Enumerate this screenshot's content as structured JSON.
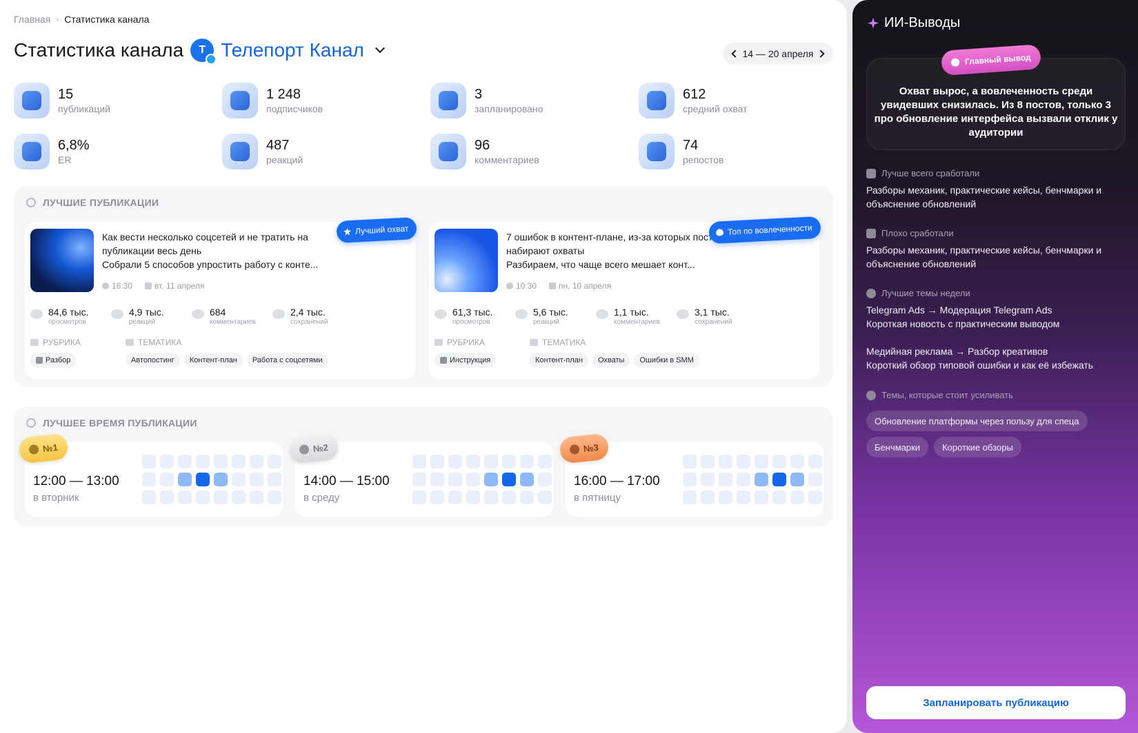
{
  "breadcrumb": {
    "home": "Главная",
    "current": "Статистика канала"
  },
  "header": {
    "title": "Статистика канала",
    "channel": "Телепорт Канал",
    "date_range": "14 — 20 апреля"
  },
  "stats": [
    {
      "value": "15",
      "label": "публикаций",
      "icon": "publications-icon"
    },
    {
      "value": "1 248",
      "label": "подписчиков",
      "icon": "subscribers-icon"
    },
    {
      "value": "3",
      "label": "запланировано",
      "icon": "scheduled-icon"
    },
    {
      "value": "612",
      "label": "средний охват",
      "icon": "reach-icon"
    },
    {
      "value": "6,8%",
      "label": "ER",
      "icon": "target-icon"
    },
    {
      "value": "487",
      "label": "реакций",
      "icon": "thumb-up-icon"
    },
    {
      "value": "96",
      "label": "комментариев",
      "icon": "comments-icon"
    },
    {
      "value": "74",
      "label": "репостов",
      "icon": "repost-icon"
    }
  ],
  "best": {
    "title": "ЛУЧШИЕ ПУБЛИКАЦИИ",
    "rubric_label": "РУБРИКА",
    "theme_label": "ТЕМАТИКА",
    "cards": [
      {
        "badge": "Лучший охват",
        "title": "Как вести несколько соцсетей и не тратить на публикации весь день",
        "excerpt": "Собрали 5 способов упростить работу с конте...",
        "time": "16:30",
        "date": "вт, 11 апреля",
        "metrics": [
          {
            "value": "84,6 тыс.",
            "label": "просмотров"
          },
          {
            "value": "4,9 тыс.",
            "label": "реакций"
          },
          {
            "value": "684",
            "label": "комментариев"
          },
          {
            "value": "2,4 тыс.",
            "label": "сохранений"
          }
        ],
        "rubric": "Разбор",
        "themes": [
          "Автопостинг",
          "Контент-план",
          "Работа с соцсетями"
        ]
      },
      {
        "badge": "Топ по вовлеченности",
        "title": "7 ошибок в контент-плане, из-за которых посты не набирают охваты",
        "excerpt": "Разбираем, что чаще всего мешает конт...",
        "time": "10:30",
        "date": "пн, 10 апреля",
        "metrics": [
          {
            "value": "61,3 тыс.",
            "label": "просмотров"
          },
          {
            "value": "5,6 тыс.",
            "label": "реакций"
          },
          {
            "value": "1,1 тыс.",
            "label": "комментариев"
          },
          {
            "value": "3,1 тыс.",
            "label": "сохранений"
          }
        ],
        "rubric": "Инструкция",
        "themes": [
          "Контент-план",
          "Охваты",
          "Ошибки в SMM"
        ]
      }
    ]
  },
  "best_time": {
    "title": "ЛУЧШЕЕ ВРЕМЯ ПУБЛИКАЦИИ",
    "slots": [
      {
        "rank": "№1",
        "range": "12:00 — 13:00",
        "day": "в вторник"
      },
      {
        "rank": "№2",
        "range": "14:00 — 15:00",
        "day": "в среду"
      },
      {
        "rank": "№3",
        "range": "16:00 — 17:00",
        "day": "в пятницу"
      }
    ]
  },
  "ai": {
    "title": "ИИ-Выводы",
    "main_badge": "Главный вывод",
    "main_text": "Охват вырос, а вовлеченность среди увидевших снизилась. Из 8 постов, только 3 про обновление интерфейса вызвали отклик у аудитории",
    "best": {
      "title": "Лучше всего сработали",
      "text": "Разборы механик, практические кейсы, бенчмарки и объяснение обновлений"
    },
    "worst": {
      "title": "Плохо сработали",
      "text": "Разборы механик, практические кейсы, бенчмарки и объяснение обновлений"
    },
    "topics": {
      "title": "Лучшие темы недели",
      "item1_title": "Telegram Ads → Модерация Telegram Ads",
      "item1_text": "Короткая новость с практическим выводом",
      "item2_title": "Медийная реклама → Разбор креативов",
      "item2_text": "Короткий обзор типовой ошибки и как её избежать"
    },
    "boost": {
      "title": "Темы, которые стоит усиливать",
      "chips": [
        "Обновление платформы через пользу для спеца",
        "Бенчмарки",
        "Короткие обзоры"
      ]
    },
    "cta": "Запланировать публикацию"
  },
  "colors": {
    "accent": "#1466e0",
    "badge_blue": "#1a6cf0",
    "heat_high": "#1266ea",
    "heat_mid": "#8fb8f6",
    "heat_low": "#e9f0fc"
  }
}
